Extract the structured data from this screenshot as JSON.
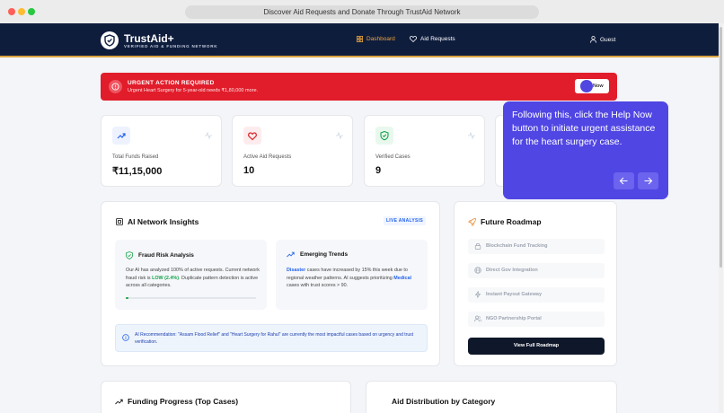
{
  "window": {
    "url_title": "Discover Aid Requests and Donate Through TrustAid Network"
  },
  "header": {
    "brand": "TrustAid+",
    "brand_sub": "VERIFIED AID & FUNDING NETWORK",
    "nav": {
      "dashboard": "Dashboard",
      "aid_requests": "Aid Requests",
      "guest": "Guest"
    }
  },
  "urgent": {
    "title": "URGENT ACTION REQUIRED",
    "desc": "Urgent Heart Surgery for 5-year-old needs ₹1,80,000 more.",
    "button": "Now"
  },
  "stats": [
    {
      "label": "Total Funds Raised",
      "value": "₹11,15,000",
      "icon": "trending-up-icon"
    },
    {
      "label": "Active Aid Requests",
      "value": "10",
      "icon": "heart-icon"
    },
    {
      "label": "Verified Cases",
      "value": "9",
      "icon": "shield-check-icon"
    }
  ],
  "tooltip": {
    "text": "Following this, click the Help Now button to initiate urgent assistance for the heart surgery case."
  },
  "insights": {
    "title": "AI Network Insights",
    "badge": "LIVE ANALYSIS",
    "fraud": {
      "title": "Fraud Risk Analysis",
      "text_a": "Our AI has analyzed 100% of active requests. Current network fraud risk is ",
      "low": "LOW (2.4%)",
      "text_b": ". Duplicate pattern detection is active across all categories.",
      "progress": 0.024
    },
    "trends": {
      "title": "Emerging Trends",
      "w1": "Disaster",
      "t1": " cases have increased by 15% this week due to regional weather patterns. AI suggests prioritizing ",
      "w2": "Medical",
      "t2": " cases with trust scores > 90."
    },
    "recommendation": "AI Recommendation: \"Assam Flood Relief\" and \"Heart Surgery for Rahul\" are currently the most impactful cases based on urgency and trust verification."
  },
  "roadmap": {
    "title": "Future Roadmap",
    "items": [
      "Blockchain Fund Tracking",
      "Direct Gov Integration",
      "Instant Payout Gateway",
      "NGO Partnership Portal"
    ],
    "button": "View Full Roadmap"
  },
  "bottom": {
    "funding": "Funding Progress (Top Cases)",
    "distribution": "Aid Distribution by Category"
  },
  "colors": {
    "accent": "#e8a33d",
    "header": "#0f1d3d",
    "urgent": "#e11d2b",
    "tooltip": "#5046e4"
  }
}
